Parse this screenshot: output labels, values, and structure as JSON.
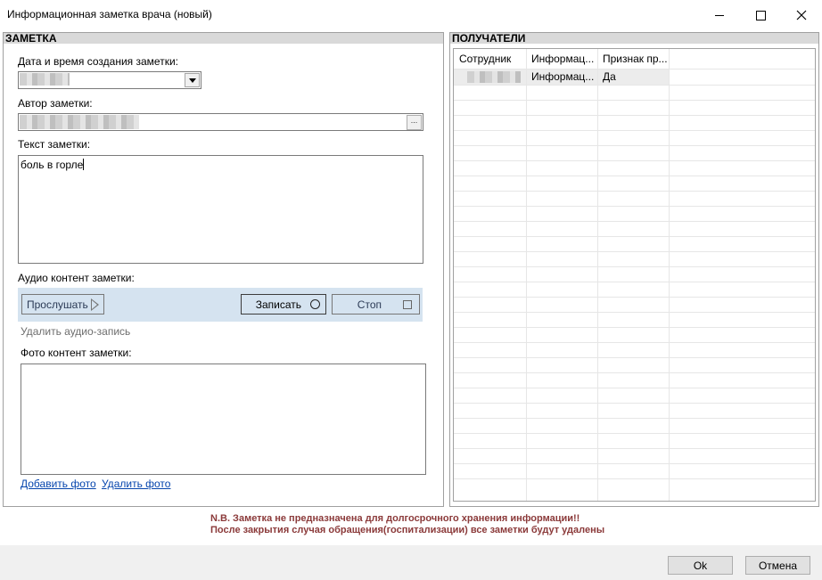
{
  "window": {
    "title": "Информационная заметка врача (новый)"
  },
  "note_panel": {
    "header": "ЗАМЕТКА",
    "date_label": "Дата и время создания заметки:",
    "author_label": "Автор заметки:",
    "text_label": "Текст заметки:",
    "text_value": "боль в горле",
    "audio_label": "Аудио контент заметки:",
    "play_button": "Прослушать",
    "record_button": "Записать",
    "stop_button": "Стоп",
    "delete_audio": "Удалить аудио-запись",
    "photo_label": "Фото контент заметки:",
    "add_photo": "Добавить фото",
    "delete_photo": "Удалить фото"
  },
  "recipients_panel": {
    "header": "ПОЛУЧАТЕЛИ",
    "columns": [
      "Сотрудник",
      "Информац...",
      "Признак пр..."
    ],
    "rows": [
      {
        "employee": "",
        "info": "Информац...",
        "flag": "Да"
      }
    ]
  },
  "warning": {
    "line1": "N.B. Заметка не предназначена для долгосрочного хранения информации!!",
    "line2": "После закрытия случая обращения(госпитализации) все заметки будут удалены"
  },
  "footer": {
    "ok": "Ok",
    "cancel": "Отмена"
  },
  "colors": {
    "audio_bar": "#d5e3f0",
    "warning_text": "#8b3a3a",
    "link": "#0645ad"
  }
}
